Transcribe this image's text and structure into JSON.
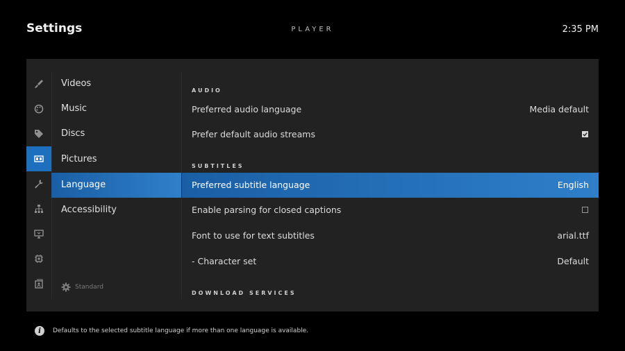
{
  "header": {
    "title": "Settings",
    "section": "PLAYER",
    "time": "2:35 PM"
  },
  "icons": [
    {
      "name": "videos-icon"
    },
    {
      "name": "music-icon"
    },
    {
      "name": "discs-icon"
    },
    {
      "name": "pictures-icon",
      "active": true
    },
    {
      "name": "language-icon"
    },
    {
      "name": "accessibility-icon"
    },
    {
      "name": "display-icon"
    },
    {
      "name": "system-icon"
    },
    {
      "name": "profiles-icon"
    }
  ],
  "categories": [
    {
      "label": "Videos"
    },
    {
      "label": "Music"
    },
    {
      "label": "Discs"
    },
    {
      "label": "Pictures"
    },
    {
      "label": "Language",
      "active": true
    },
    {
      "label": "Accessibility"
    }
  ],
  "settings_level": {
    "label": "Standard",
    "icon": "gear-icon"
  },
  "sections": {
    "audio": "AUDIO",
    "subtitles": "SUBTITLES",
    "download": "DOWNLOAD SERVICES"
  },
  "audio": {
    "preferred_language": {
      "label": "Preferred audio language",
      "value": "Media default"
    },
    "prefer_default_streams": {
      "label": "Prefer default audio streams",
      "checked": true
    }
  },
  "subtitles": {
    "preferred_language": {
      "label": "Preferred subtitle language",
      "value": "English",
      "selected": true
    },
    "closed_captions": {
      "label": "Enable parsing for closed captions",
      "checked": false
    },
    "font": {
      "label": "Font to use for text subtitles",
      "value": "arial.ttf"
    },
    "charset": {
      "label": "- Character set",
      "value": "Default"
    }
  },
  "footer": {
    "info_icon": "i",
    "text": "Defaults to the selected subtitle language if more than one language is available."
  },
  "colors": {
    "accent": "#1f6fbf",
    "panel": "#222223",
    "background": "#000000"
  }
}
